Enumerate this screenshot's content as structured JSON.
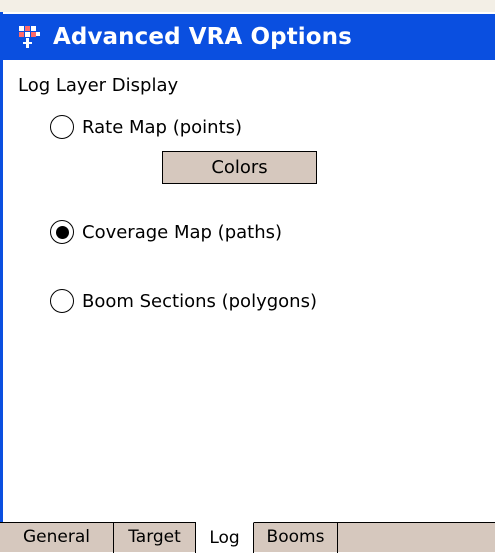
{
  "window": {
    "title": "Advanced VRA Options",
    "icon": "vra-app-icon"
  },
  "section": {
    "label": "Log Layer Display"
  },
  "options": [
    {
      "label": "Rate Map (points)",
      "checked": false
    },
    {
      "label": "Coverage Map (paths)",
      "checked": true
    },
    {
      "label": "Boom Sections (polygons)",
      "checked": false
    }
  ],
  "buttons": {
    "colors_label": "Colors"
  },
  "tabs": [
    {
      "label": "General",
      "active": false
    },
    {
      "label": "Target",
      "active": false
    },
    {
      "label": "Log",
      "active": true
    },
    {
      "label": "Booms",
      "active": false
    }
  ],
  "colors": {
    "title_bar": "#0A4FE0",
    "tab_bar": "#D6C8BE",
    "button_face": "#D6C8BE"
  }
}
